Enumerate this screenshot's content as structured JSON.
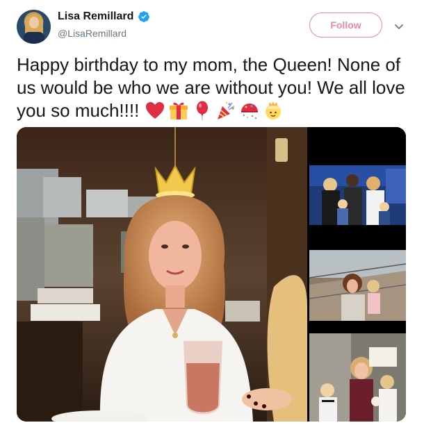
{
  "author": {
    "display_name": "Lisa Remillard",
    "handle": "@LisaRemillard",
    "verified": true
  },
  "actions": {
    "follow_label": "Follow"
  },
  "tweet": {
    "text": "Happy birthday to my mom, the Queen! None of us would be who we are without you! We all love you so much!!!!",
    "emojis": [
      "red-heart",
      "wrapped-gift",
      "balloon",
      "party-popper",
      "confetti-ball",
      "princess"
    ]
  },
  "media": {
    "count": 4
  },
  "colors": {
    "accent": "#e0245e",
    "verified": "#1da1f2",
    "text": "#14171a",
    "secondary_text": "#657786"
  }
}
